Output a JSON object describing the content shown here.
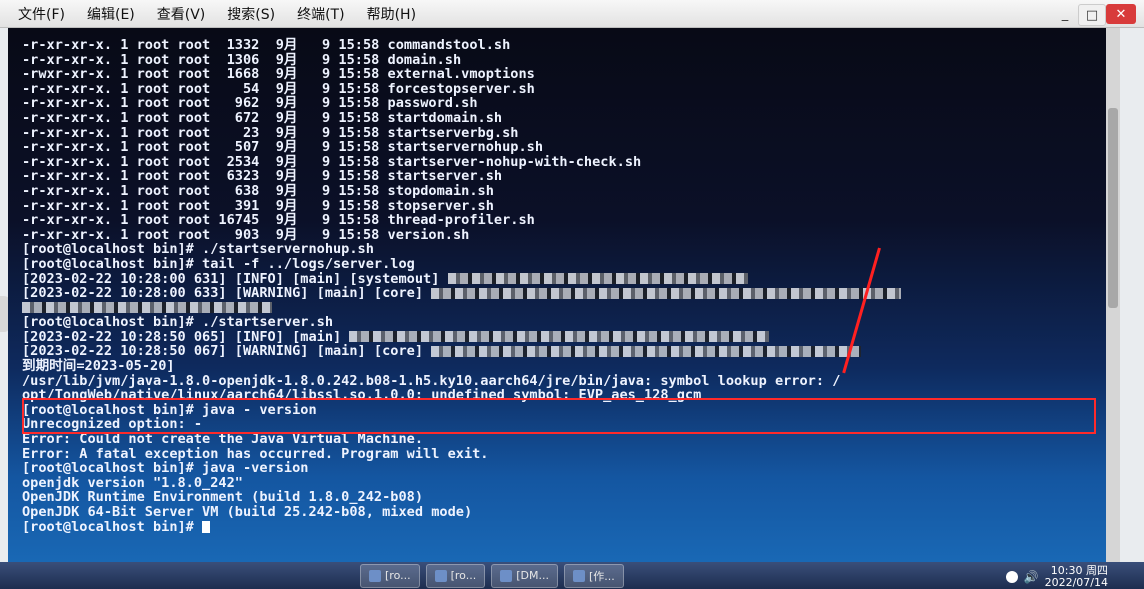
{
  "menu": {
    "items": [
      "文件(F)",
      "编辑(E)",
      "查看(V)",
      "搜索(S)",
      "终端(T)",
      "帮助(H)"
    ]
  },
  "window_controls": {
    "minimize": "_",
    "maximize": "□",
    "close": "✕"
  },
  "terminal": {
    "lines": [
      "-r-xr-xr-x. 1 root root  1332  9月   9 15:58 commandstool.sh",
      "-r-xr-xr-x. 1 root root  1306  9月   9 15:58 domain.sh",
      "-rwxr-xr-x. 1 root root  1668  9月   9 15:58 external.vmoptions",
      "-r-xr-xr-x. 1 root root    54  9月   9 15:58 forcestopserver.sh",
      "-r-xr-xr-x. 1 root root   962  9月   9 15:58 password.sh",
      "-r-xr-xr-x. 1 root root   672  9月   9 15:58 startdomain.sh",
      "-r-xr-xr-x. 1 root root    23  9月   9 15:58 startserverbg.sh",
      "-r-xr-xr-x. 1 root root   507  9月   9 15:58 startservernohup.sh",
      "-r-xr-xr-x. 1 root root  2534  9月   9 15:58 startserver-nohup-with-check.sh",
      "-r-xr-xr-x. 1 root root  6323  9月   9 15:58 startserver.sh",
      "-r-xr-xr-x. 1 root root   638  9月   9 15:58 stopdomain.sh",
      "-r-xr-xr-x. 1 root root   391  9月   9 15:58 stopserver.sh",
      "-r-xr-xr-x. 1 root root 16745  9月   9 15:58 thread-profiler.sh",
      "-r-xr-xr-x. 1 root root   903  9月   9 15:58 version.sh",
      "[root@localhost bin]# ./startservernohup.sh",
      "[root@localhost bin]# tail -f ../logs/server.log",
      "[2023-02-22 10:28:00 631] [INFO] [main] [systemout]",
      "[2023-02-22 10:28:00 633] [WARNING] [main] [core]",
      "",
      "",
      "[root@localhost bin]# ./startserver.sh",
      "[2023-02-22 10:28:50 065] [INFO] [main]",
      "[2023-02-22 10:28:50 067] [WARNING] [main] [core]",
      "到期时间=2023-05-20]",
      "/usr/lib/jvm/java-1.8.0-openjdk-1.8.0.242.b08-1.h5.ky10.aarch64/jre/bin/java: symbol lookup error: /",
      "opt/TongWeb/native/linux/aarch64/libssl.so.1.0.0: undefined symbol: EVP_aes_128_gcm",
      "[root@localhost bin]# java - version",
      "Unrecognized option: -",
      "Error: Could not create the Java Virtual Machine.",
      "Error: A fatal exception has occurred. Program will exit.",
      "[root@localhost bin]# java -version",
      "openjdk version \"1.8.0_242\"",
      "OpenJDK Runtime Environment (build 1.8.0_242-b08)",
      "OpenJDK 64-Bit Server VM (build 25.242-b08, mixed mode)",
      "[root@localhost bin]# "
    ]
  },
  "taskbar": {
    "items": [
      "[ro...",
      "[ro...",
      "[DM...",
      "[作..."
    ],
    "clock_time": "10:30 周四",
    "clock_date": "2022/07/14"
  },
  "colors": {
    "highlight_box": "#ff2a2a",
    "terminal_text": "#eef3ff"
  }
}
